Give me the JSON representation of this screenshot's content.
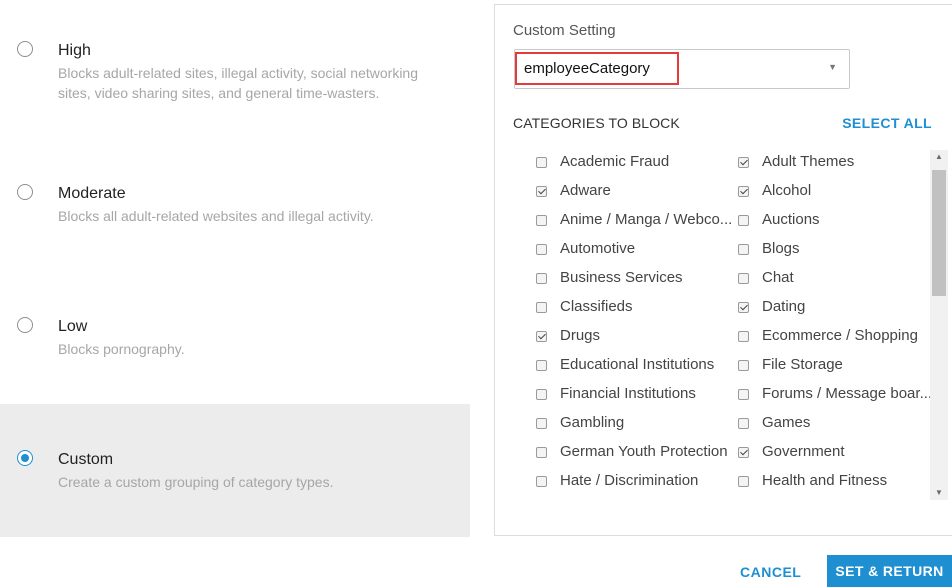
{
  "options": [
    {
      "title": "High",
      "description": "Blocks adult-related sites, illegal activity, social networking sites, video sharing sites, and general time-wasters.",
      "selected": false
    },
    {
      "title": "Moderate",
      "description": "Blocks all adult-related websites and illegal activity.",
      "selected": false
    },
    {
      "title": "Low",
      "description": "Blocks pornography.",
      "selected": false
    },
    {
      "title": "Custom",
      "description": "Create a custom grouping of category types.",
      "selected": true
    }
  ],
  "panel": {
    "custom_setting_label": "Custom Setting",
    "custom_setting_value": "employeeCategory",
    "categories_heading": "CATEGORIES TO BLOCK",
    "select_all": "SELECT ALL",
    "categories": [
      {
        "label": "Academic Fraud",
        "checked": false
      },
      {
        "label": "Adult Themes",
        "checked": true
      },
      {
        "label": "Adware",
        "checked": true
      },
      {
        "label": "Alcohol",
        "checked": true
      },
      {
        "label": "Anime / Manga / Webco...",
        "checked": false
      },
      {
        "label": "Auctions",
        "checked": false
      },
      {
        "label": "Automotive",
        "checked": false
      },
      {
        "label": "Blogs",
        "checked": false
      },
      {
        "label": "Business Services",
        "checked": false
      },
      {
        "label": "Chat",
        "checked": false
      },
      {
        "label": "Classifieds",
        "checked": false
      },
      {
        "label": "Dating",
        "checked": true
      },
      {
        "label": "Drugs",
        "checked": true
      },
      {
        "label": "Ecommerce / Shopping",
        "checked": false
      },
      {
        "label": "Educational Institutions",
        "checked": false
      },
      {
        "label": "File Storage",
        "checked": false
      },
      {
        "label": "Financial Institutions",
        "checked": false
      },
      {
        "label": "Forums / Message boar...",
        "checked": false
      },
      {
        "label": "Gambling",
        "checked": false
      },
      {
        "label": "Games",
        "checked": false
      },
      {
        "label": "German Youth Protection",
        "checked": false
      },
      {
        "label": "Government",
        "checked": true
      },
      {
        "label": "Hate / Discrimination",
        "checked": false
      },
      {
        "label": "Health and Fitness",
        "checked": false
      }
    ]
  },
  "footer": {
    "cancel": "CANCEL",
    "set_return": "SET & RETURN"
  },
  "colors": {
    "accent": "#1e8fd1",
    "highlight_box": "#e23b3b",
    "selected_bg": "#ececec"
  }
}
